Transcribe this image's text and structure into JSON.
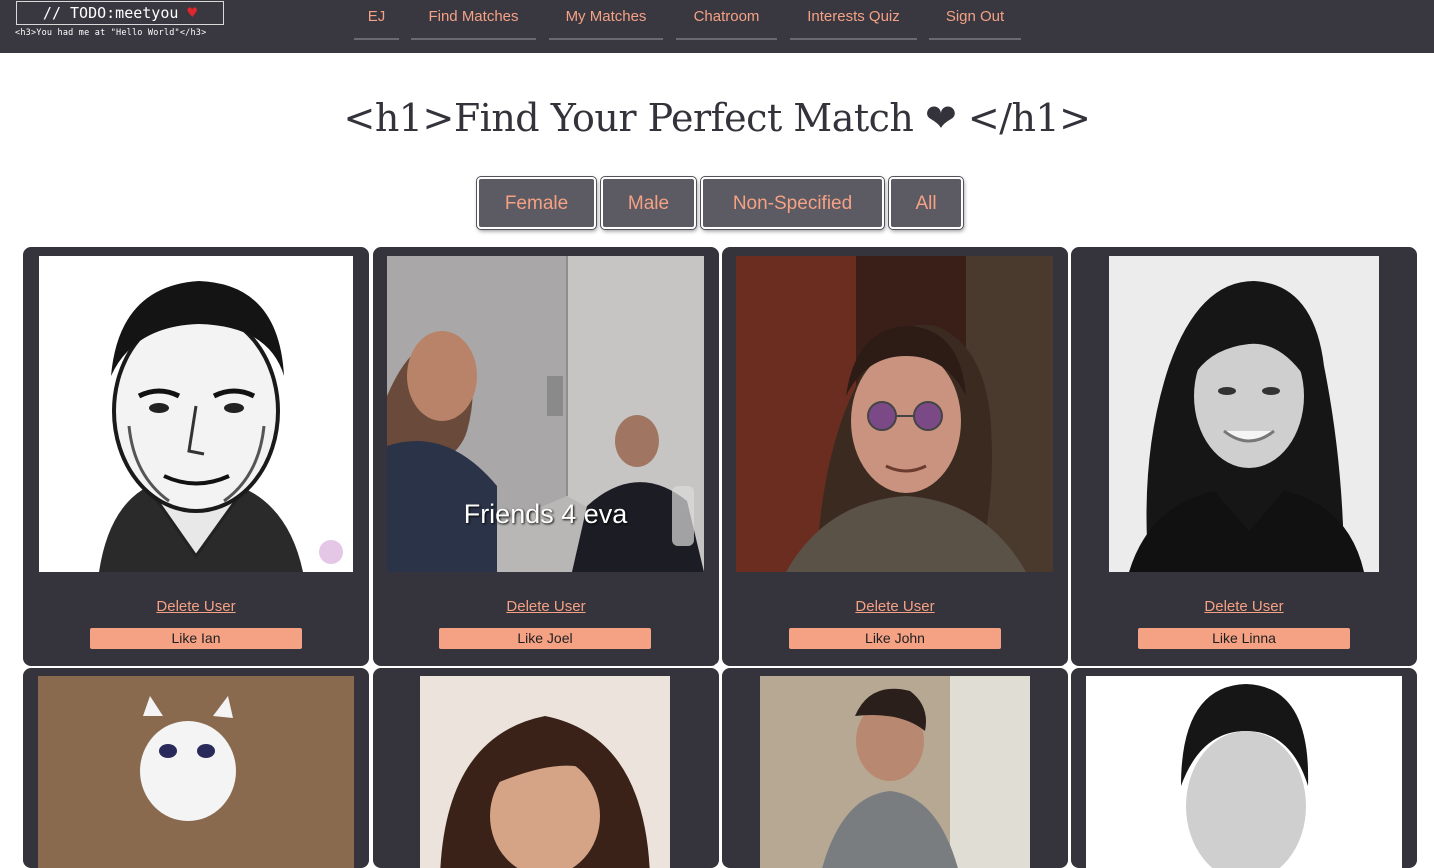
{
  "brand": {
    "logo_text": "// TODO:meetyou",
    "logo_heart": "♥",
    "tagline": "<h3>You had me at \"Hello World\"</h3>"
  },
  "nav": {
    "items": [
      {
        "label": "EJ"
      },
      {
        "label": "Find Matches"
      },
      {
        "label": "My Matches"
      },
      {
        "label": "Chatroom"
      },
      {
        "label": "Interests Quiz"
      },
      {
        "label": "Sign Out"
      }
    ]
  },
  "page": {
    "title": "<h1>Find Your Perfect Match ❤ </h1>"
  },
  "filters": [
    "Female",
    "Male",
    "Non-Specified",
    "All"
  ],
  "users": [
    {
      "like_label": "Like Ian",
      "delete_label": "Delete User",
      "photo": "sketch-portrait-man-icon"
    },
    {
      "like_label": "Like Joel",
      "delete_label": "Delete User",
      "photo": "friends-photo-icon",
      "caption": "Friends 4 eva"
    },
    {
      "like_label": "Like John",
      "delete_label": "Delete User",
      "photo": "man-round-glasses-icon"
    },
    {
      "like_label": "Like Linna",
      "delete_label": "Delete User",
      "photo": "woman-portrait-icon"
    }
  ],
  "colors": {
    "nav_bg": "#393740",
    "accent": "#f4a184",
    "card_bg": "#35333b",
    "title": "#34323a"
  }
}
